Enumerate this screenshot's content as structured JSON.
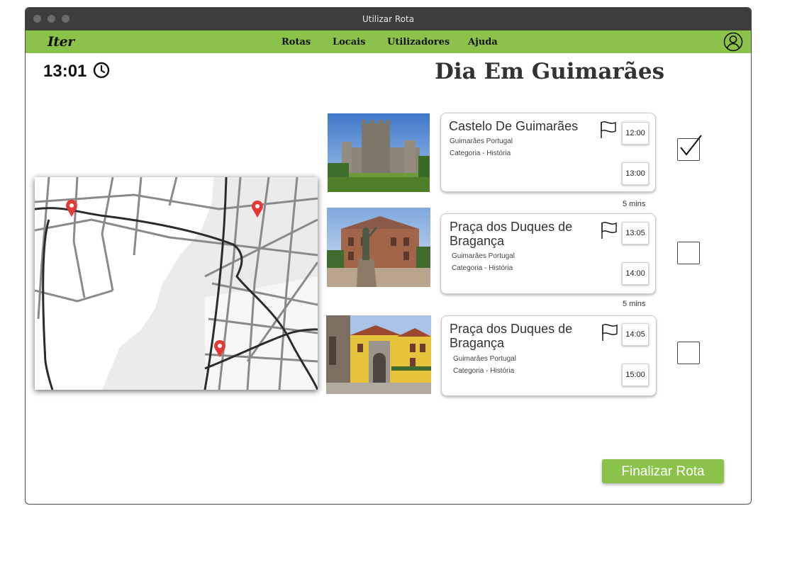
{
  "window": {
    "title": "Utilizar Rota"
  },
  "navbar": {
    "brand": "Iter",
    "items": [
      {
        "label": "Rotas"
      },
      {
        "label": "Locais"
      },
      {
        "label": "Utilizadores"
      },
      {
        "label": "Ajuda"
      }
    ],
    "profile_icon": "user-circle-icon"
  },
  "clock": {
    "time": "13:01",
    "icon": "clock-icon"
  },
  "route": {
    "title": "Dia Em Guimarães"
  },
  "map": {
    "markers": 3,
    "marker_color": "#e53935"
  },
  "stops": [
    {
      "name": "Castelo De Guimarães",
      "location": "Guimarães Portugal",
      "category": "Categoria - História",
      "start": "12:00",
      "end": "13:00",
      "checked": true,
      "flag_icon": "flag-icon"
    },
    {
      "name": "Praça dos Duques de Bragança",
      "location": "Guimarães Portugal",
      "category": "Categoria - História",
      "start": "13:05",
      "end": "14:00",
      "checked": false,
      "flag_icon": "flag-icon"
    },
    {
      "name": "Praça dos Duques de Bragança",
      "location": "Guimarães Portugal",
      "category": "Categoria - História",
      "start": "14:05",
      "end": "15:00",
      "checked": false,
      "flag_icon": "flag-icon"
    }
  ],
  "gaps": [
    "5 mins",
    "5 mins"
  ],
  "actions": {
    "finish_label": "Finalizar Rota"
  },
  "colors": {
    "accent": "#8bc34a",
    "titlebar": "#3d3d3d"
  }
}
